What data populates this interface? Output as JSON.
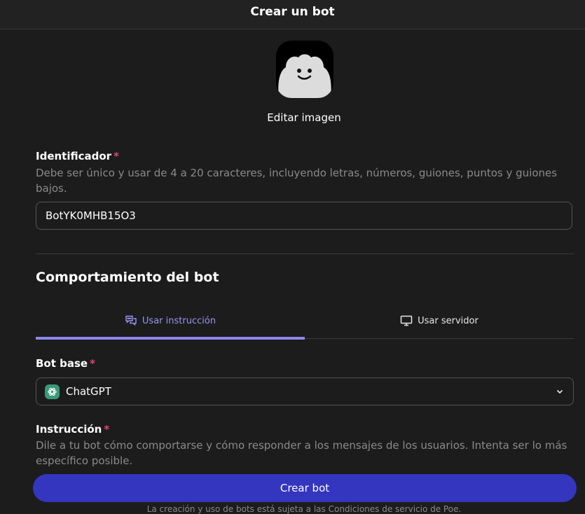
{
  "header": {
    "title": "Crear un bot"
  },
  "avatar": {
    "edit_label": "Editar imagen"
  },
  "identifier": {
    "label": "Identificador",
    "required_mark": "*",
    "help": "Debe ser único y usar de 4 a 20 caracteres, incluyendo letras, números, guiones, puntos y guiones bajos.",
    "value": "BotYK0MHB15O3"
  },
  "behavior": {
    "title": "Comportamiento del bot",
    "tabs": [
      {
        "label": "Usar instrucción",
        "icon": "chat-bubbles-icon",
        "active": true
      },
      {
        "label": "Usar servidor",
        "icon": "monitor-icon",
        "active": false
      }
    ]
  },
  "base_bot": {
    "label": "Bot base",
    "required_mark": "*",
    "selected": "ChatGPT",
    "icon": "chatgpt-icon"
  },
  "instruction": {
    "label": "Instrucción",
    "required_mark": "*",
    "help": "Dile a tu bot cómo comportarse y cómo responder a los mensajes de los usuarios. Intenta ser lo más específico posible."
  },
  "footer": {
    "create_label": "Crear bot",
    "terms": "La creación y uso de bots está sujeta a las Condiciones de servicio de Poe."
  },
  "colors": {
    "accent": "#8d87ea",
    "button": "#3436c0",
    "required": "#e0457b",
    "background": "#1c1c1c"
  }
}
